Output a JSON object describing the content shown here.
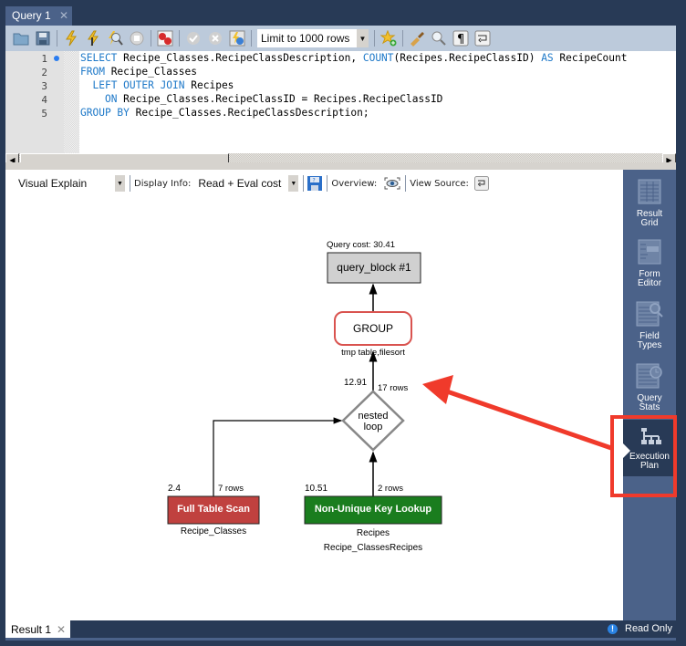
{
  "query_tab": {
    "label": "Query 1",
    "close": "✕"
  },
  "toolbar": {
    "icons": [
      "open-folder-icon",
      "save-icon",
      "execute-icon",
      "execute-current-icon",
      "explain-icon",
      "stop-icon",
      "toggle-error-icon",
      "commit-icon",
      "rollback-icon",
      "autocommit-icon",
      "add-snippet-icon",
      "beautify-icon",
      "find-icon",
      "invisible-chars-icon",
      "word-wrap-icon"
    ],
    "limit_select": "Limit to 1000 rows"
  },
  "editor": {
    "line_numbers": [
      "1",
      "2",
      "3",
      "4",
      "5"
    ],
    "lines": [
      [
        {
          "t": "SELECT",
          "k": true
        },
        {
          "t": " Recipe_Classes.RecipeClassDescription, "
        },
        {
          "t": "COUNT",
          "k": true
        },
        {
          "t": "(Recipes.RecipeClassID) "
        },
        {
          "t": "AS",
          "k": true
        },
        {
          "t": " RecipeCount"
        }
      ],
      [
        {
          "t": "FROM",
          "k": true
        },
        {
          "t": " Recipe_Classes"
        }
      ],
      [
        {
          "t": "  "
        },
        {
          "t": "LEFT OUTER JOIN",
          "k": true
        },
        {
          "t": " Recipes"
        }
      ],
      [
        {
          "t": "    "
        },
        {
          "t": "ON",
          "k": true
        },
        {
          "t": " Recipe_Classes.RecipeClassID = Recipes.RecipeClassID"
        }
      ],
      [
        {
          "t": "GROUP BY",
          "k": true
        },
        {
          "t": " Recipe_Classes.RecipeClassDescription;"
        }
      ]
    ]
  },
  "explain_toolbar": {
    "view_select": "Visual Explain",
    "display_info_label": "Display Info:",
    "display_info_select": "Read + Eval cost",
    "overview_label": "Overview:",
    "view_source_label": "View Source:"
  },
  "plan": {
    "query_cost": "Query cost: 30.41",
    "query_block": "query_block #1",
    "group": "GROUP",
    "group_note": "tmp table,filesort",
    "nested_cost": "12.91",
    "nested_rows": "17 rows",
    "nested_label_1": "nested",
    "nested_label_2": "loop",
    "scan_cost": "2.4",
    "scan_rows": "7 rows",
    "scan_label": "Full Table Scan",
    "scan_table": "Recipe_Classes",
    "lookup_cost": "10.51",
    "lookup_rows": "2 rows",
    "lookup_label": "Non-Unique Key Lookup",
    "lookup_table": "Recipes",
    "lookup_key": "Recipe_ClassesRecipes",
    "colors": {
      "scan": "#c0413f",
      "lookup": "#1a7d1e",
      "group_border": "#d9534f",
      "query_block": "#d0d0d0"
    }
  },
  "sidebar": {
    "items": [
      {
        "l1": "Result",
        "l2": "Grid"
      },
      {
        "l1": "Form",
        "l2": "Editor"
      },
      {
        "l1": "Field",
        "l2": "Types"
      },
      {
        "l1": "Query",
        "l2": "Stats"
      },
      {
        "l1": "Execution",
        "l2": "Plan"
      }
    ]
  },
  "result_tab": {
    "label": "Result 1",
    "close": "✕"
  },
  "status": {
    "read_only": "Read Only",
    "info_glyph": "!"
  },
  "annotation": {
    "color": "#f03a2b"
  }
}
